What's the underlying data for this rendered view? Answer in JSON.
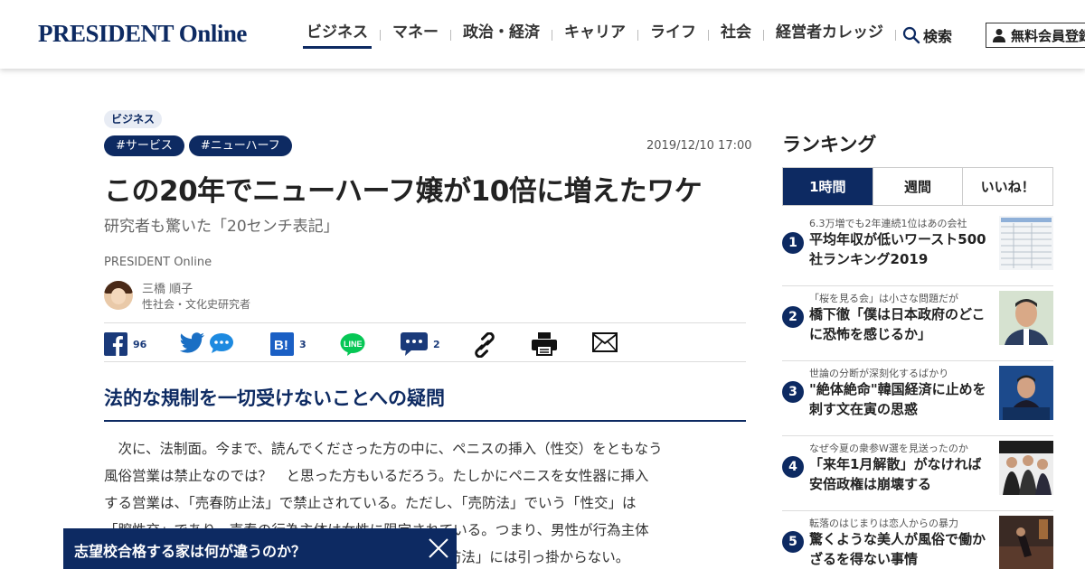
{
  "header": {
    "logo": "PRESIDENT Online",
    "nav": [
      "ビジネス",
      "マネー",
      "政治・経済",
      "キャリア",
      "ライフ",
      "社会",
      "経営者カレッジ"
    ],
    "search_label": "検索",
    "register_label": "無料会員登録"
  },
  "article": {
    "category": "ビジネス",
    "tags": [
      "#サービス",
      "#ニューハーフ"
    ],
    "date": "2019/12/10 17:00",
    "title": "この20年でニューハーフ嬢が10倍に増えたワケ",
    "subtitle": "研究者も驚いた「20センチ表記」",
    "source": "PRESIDENT Online",
    "author_name": "三橋 順子",
    "author_role": "性社会・文化史研究者",
    "share": {
      "facebook_count": "96",
      "hatena_count": "3",
      "comment_count": "2"
    },
    "section_heading": "法的な規制を一切受けないことへの疑問",
    "body_lines": [
      "　次に、法制面。今まで、読んでくださった方の中に、ペニスの挿入（性交）をともなう",
      "風俗営業は禁止なのでは？　と思った方もいるだろう。たしかにペニスを女性器に挿入",
      "する営業は、「売春防止法」で禁止されている。ただし、「売防法」でいう「性交」は",
      "「膣性交」であり、売春の行為主体は女性に限定されている。つまり、男性が行為主体",
      "　　　　　　　　　　　　　　　　　　　　　　　「売防法」には引っ掛からない。"
    ]
  },
  "banner": {
    "text": "志望校合格する家は何が違うのか？"
  },
  "ranking": {
    "title": "ランキング",
    "tabs": [
      "1時間",
      "週間",
      "いいね！"
    ],
    "items": [
      {
        "rank": "1",
        "kicker": "6.3万増でも2年連続1位はあの会社",
        "headline": "平均年収が低いワースト500社ランキング2019"
      },
      {
        "rank": "2",
        "kicker": "「桜を見る会」は小さな問題だが",
        "headline": "橋下徹「僕は日本政府のどこに恐怖を感じるか」"
      },
      {
        "rank": "3",
        "kicker": "世論の分断が深刻化するばかり",
        "headline": "\"絶体絶命\"韓国経済に止めを刺す文在寅の思惑"
      },
      {
        "rank": "4",
        "kicker": "なぜ今夏の衆参W選を見送ったのか",
        "headline": "「来年1月解散」がなければ安倍政権は崩壊する"
      },
      {
        "rank": "5",
        "kicker": "転落のはじまりは恋人からの暴力",
        "headline": "驚くような美人が風俗で働かざるを得ない事情"
      }
    ]
  },
  "colors": {
    "brand_navy": "#0d2a62",
    "twitter": "#1da1f2",
    "facebook": "#1877f2",
    "line": "#06c755"
  }
}
